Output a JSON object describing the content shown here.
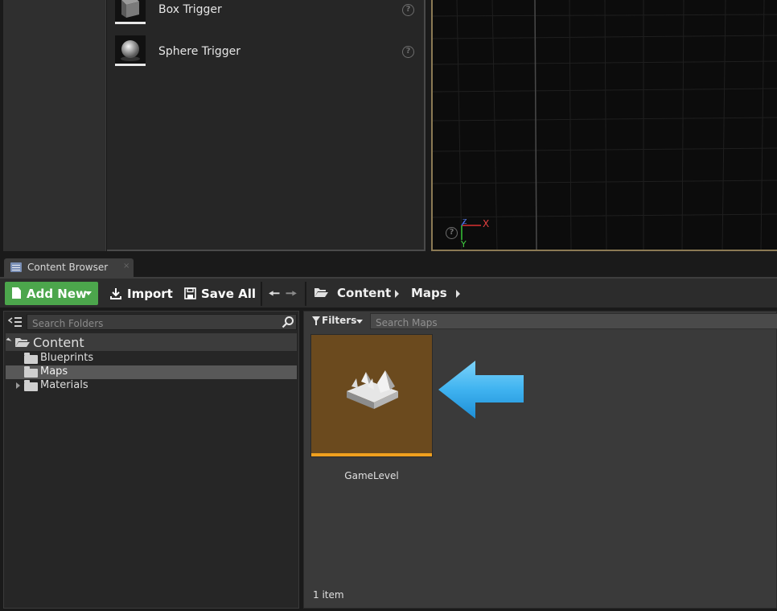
{
  "modes_panel": {
    "items": [
      {
        "label": "Box Trigger",
        "icon": "box-trigger-icon"
      },
      {
        "label": "Sphere Trigger",
        "icon": "sphere-trigger-icon"
      }
    ],
    "help_glyph": "?"
  },
  "viewport": {
    "axis_x": "X",
    "axis_y": "Y",
    "axis_z": "Z",
    "help_glyph": "?"
  },
  "content_browser": {
    "tab_label": "Content Browser",
    "tab_close": "×",
    "toolbar": {
      "add_new_label": "Add New",
      "import_label": "Import",
      "save_all_label": "Save All"
    },
    "breadcrumb": [
      "Content",
      "Maps"
    ],
    "folders": {
      "search_placeholder": "Search Folders",
      "root": "Content",
      "children": [
        {
          "label": "Blueprints",
          "selected": false,
          "expandable": false
        },
        {
          "label": "Maps",
          "selected": true,
          "expandable": false
        },
        {
          "label": "Materials",
          "selected": false,
          "expandable": true
        }
      ]
    },
    "assets": {
      "filters_label": "Filters",
      "search_placeholder": "Search Maps",
      "items": [
        {
          "name": "GameLevel",
          "type": "map"
        }
      ],
      "count_label": "1 item"
    }
  },
  "colors": {
    "add_new_green": "#4ca64c",
    "map_tile_brown": "#6b4a1e",
    "map_tile_bar": "#f0a01e",
    "callout_arrow": "#3fb3f0",
    "viewport_border": "#8b7a54"
  }
}
